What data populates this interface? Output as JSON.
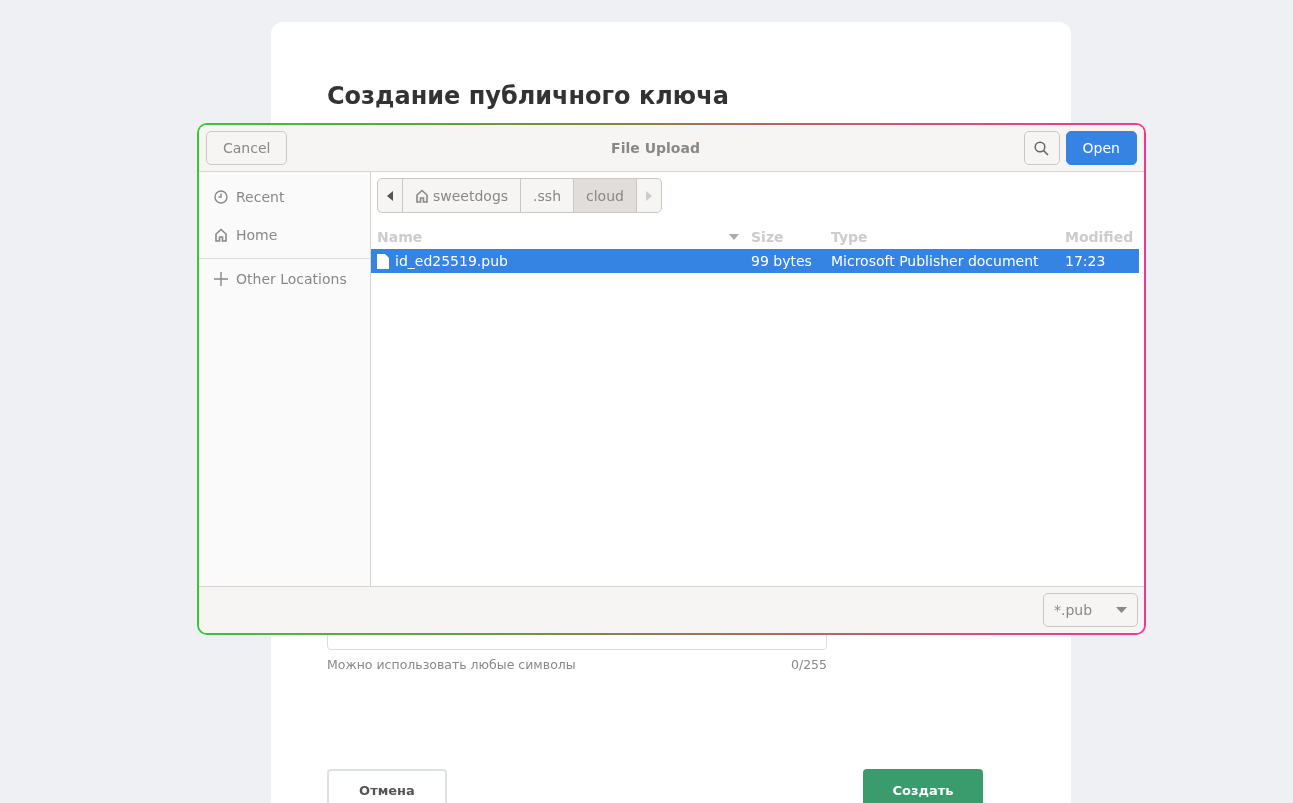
{
  "page": {
    "title": "Создание публичного ключа",
    "hint": "Можно использовать любые символы",
    "counter": "0/255",
    "buttons": [
      {
        "label": "Отмена",
        "kind": "secondary"
      },
      {
        "label": "Создать",
        "kind": "primary"
      }
    ]
  },
  "dialog": {
    "title": "File Upload",
    "cancel": "Cancel",
    "open": "Open",
    "sidebar": [
      {
        "label": "Recent",
        "kind": "recent"
      },
      {
        "label": "Home",
        "kind": "home"
      },
      {
        "label": "Other Locations",
        "kind": "other"
      }
    ],
    "path": [
      {
        "label": "sweetdogs",
        "kind": "home",
        "selected": false
      },
      {
        "label": ".ssh",
        "kind": "folder",
        "selected": false
      },
      {
        "label": "cloud",
        "kind": "folder",
        "selected": true
      }
    ],
    "columns": [
      {
        "label": "Name",
        "sorted": true
      },
      {
        "label": "Size",
        "sorted": false
      },
      {
        "label": "Type",
        "sorted": false
      },
      {
        "label": "Modified",
        "sorted": false
      }
    ],
    "rows": [
      {
        "cells": [
          "id_ed25519.pub",
          "99 bytes",
          "Microsoft Publisher document",
          "17:23"
        ],
        "selected": true
      }
    ],
    "filter": "*.pub"
  }
}
